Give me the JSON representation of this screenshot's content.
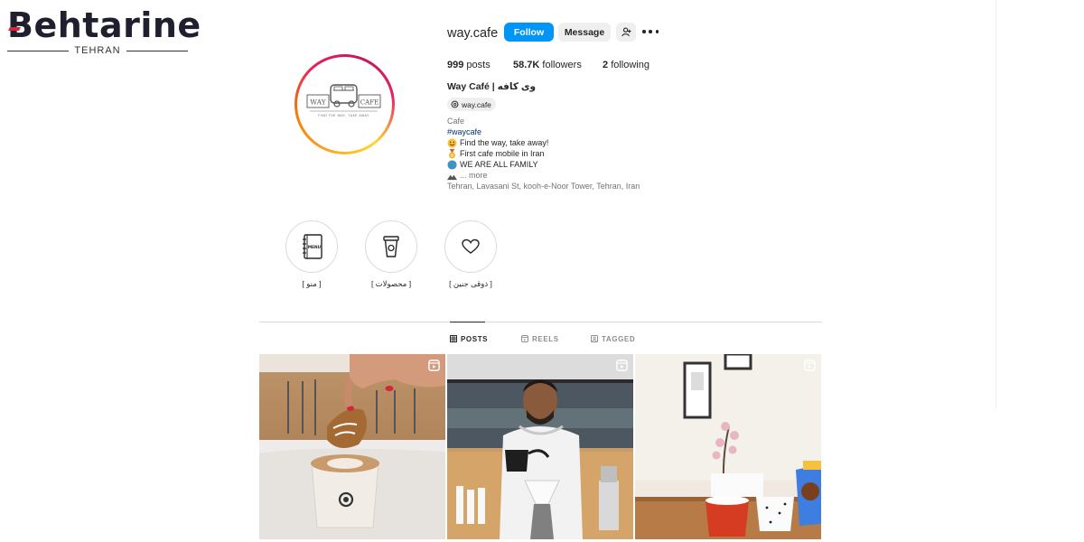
{
  "watermark": {
    "logo_text": "Behtarine",
    "city": "TEHRAN"
  },
  "profile": {
    "username": "way.cafe",
    "avatar_logo": {
      "left": "WAY",
      "right": "CAFE",
      "tagline": "FIND THE WAY, TAKE AWAY"
    },
    "buttons": {
      "follow": "Follow",
      "message": "Message"
    },
    "stats": {
      "posts_value": "999",
      "posts_label": "posts",
      "followers_value": "58.7K",
      "followers_label": "followers",
      "following_value": "2",
      "following_label": "following"
    },
    "full_name": "Way Café | وی کافه",
    "threads_handle": "way.cafe",
    "bio": {
      "category": "Cafe",
      "hashtag": "#waycafe",
      "lines": [
        "Find the way, take away!",
        "First cafe mobile in Iran",
        "WE ARE ALL FAMILY"
      ],
      "more": "... more",
      "address": "Tehran, Lavasani St, kooh-e-Noor Tower, Tehran, Iran"
    }
  },
  "highlights": [
    {
      "label": "[ منو ]",
      "icon": "menu-book-icon"
    },
    {
      "label": "[ محصولات ]",
      "icon": "coffee-cup-icon"
    },
    {
      "label": "[ ذوقی جنین ]",
      "icon": "heart-icon"
    }
  ],
  "tabs": [
    {
      "label": "POSTS",
      "icon": "grid-icon",
      "active": true
    },
    {
      "label": "REELS",
      "icon": "reels-icon",
      "active": false
    },
    {
      "label": "TAGGED",
      "icon": "tagged-icon",
      "active": false
    }
  ],
  "posts": [
    {
      "type": "reel",
      "subject": "latte with cookie"
    },
    {
      "type": "reel",
      "subject": "barista pour-over"
    },
    {
      "type": "reel",
      "subject": "cups and orchid"
    }
  ],
  "colors": {
    "follow_blue": "#0095f6",
    "link_blue": "#00376b",
    "muted": "#737373"
  }
}
